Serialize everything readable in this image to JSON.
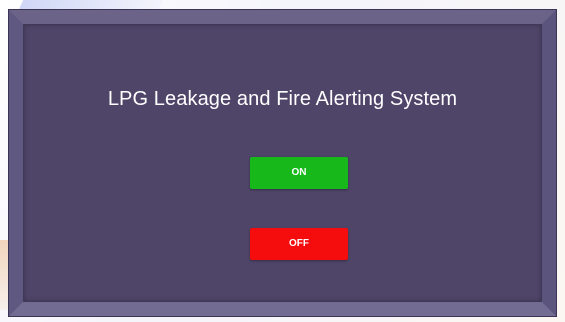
{
  "panel": {
    "title": "LPG Leakage and Fire Alerting System"
  },
  "controls": {
    "on_label": "ON",
    "off_label": "OFF"
  },
  "colors": {
    "panel_background": "#4f4569",
    "on_button": "#16b81a",
    "off_button": "#f50c0c",
    "text": "#ffffff"
  }
}
